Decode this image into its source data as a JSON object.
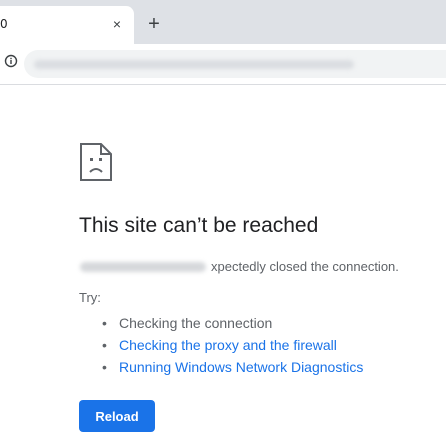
{
  "tab": {
    "title": "0",
    "close_glyph": "×"
  },
  "new_tab_glyph": "+",
  "toolbar": {
    "info_icon": "info-circle-icon"
  },
  "error": {
    "icon": "sad-document-icon",
    "title": "This site can’t be reached",
    "message": "xpectedly closed the connection.",
    "try_label": "Try:",
    "suggestions": [
      "Checking the connection",
      "Checking the proxy and the firewall",
      "Running Windows Network Diagnostics"
    ],
    "reload_label": "Reload"
  },
  "colors": {
    "accent": "#1a73e8",
    "text": "#202124",
    "muted": "#5f6368",
    "tabstrip": "#dee1e6"
  }
}
